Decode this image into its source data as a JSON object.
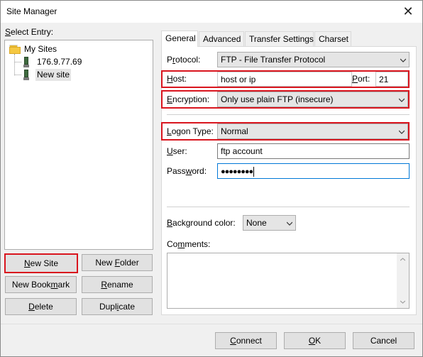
{
  "window": {
    "title": "Site Manager",
    "close_icon": "close-icon"
  },
  "left": {
    "select_entry_label": "Select Entry:",
    "tree": {
      "root": {
        "label": "My Sites",
        "icon": "folder-icon"
      },
      "children": [
        {
          "label": "176.9.77.69",
          "icon": "site-icon",
          "selected": false
        },
        {
          "label": "New site",
          "icon": "site-icon",
          "selected": true
        }
      ]
    },
    "buttons": {
      "new_site": "New Site",
      "new_folder": "New Folder",
      "new_bookmark": "New Bookmark",
      "rename": "Rename",
      "delete": "Delete",
      "duplicate": "Duplicate"
    }
  },
  "tabs": [
    {
      "label": "General",
      "active": true
    },
    {
      "label": "Advanced",
      "active": false
    },
    {
      "label": "Transfer Settings",
      "active": false
    },
    {
      "label": "Charset",
      "active": false
    }
  ],
  "general": {
    "protocol_label": "Protocol:",
    "protocol_value": "FTP - File Transfer Protocol",
    "host_label": "Host:",
    "host_value": "host or ip",
    "port_label": "Port:",
    "port_value": "21",
    "encryption_label": "Encryption:",
    "encryption_value": "Only use plain FTP (insecure)",
    "logon_type_label": "Logon Type:",
    "logon_type_value": "Normal",
    "user_label": "User:",
    "user_value": "ftp account",
    "password_label": "Password:",
    "password_value": "●●●●●●●●",
    "background_color_label": "Background color:",
    "background_color_value": "None",
    "comments_label": "Comments:"
  },
  "footer": {
    "connect": "Connect",
    "ok": "OK",
    "cancel": "Cancel"
  },
  "colors": {
    "highlight_red": "#d9151e",
    "focus_blue": "#0078d7"
  }
}
